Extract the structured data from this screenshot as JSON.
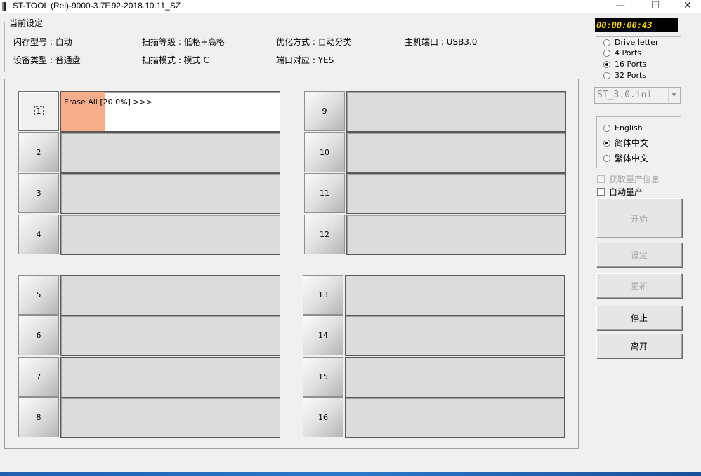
{
  "window": {
    "title": "ST-TOOL (Rel)-9000-3.7F.92-2018.10.11_SZ",
    "minimize_glyph": "—",
    "maximize_glyph": "☐",
    "close_glyph": "✕"
  },
  "settings": {
    "legend": "当前设定",
    "flash_model": "闪存型号 : 自动",
    "scan_level": "扫描等级 : 低格+高格",
    "optimize": "优化方式 : 自动分类",
    "host_port": "主机端口 : USB3.0",
    "device_type": "设备类型 : 普通盘",
    "scan_mode": "扫描模式 : 模式 C",
    "port_map": "端口对应 : YES"
  },
  "timer": "00:00:00:43",
  "port_mode": {
    "options": [
      {
        "label": "Drive letter",
        "selected": false
      },
      {
        "label": "4 Ports",
        "selected": false
      },
      {
        "label": "16 Ports",
        "selected": true
      },
      {
        "label": "32 Ports",
        "selected": false
      }
    ]
  },
  "ini_file": "ST_3.0.ini",
  "language": {
    "options": [
      {
        "label": "English",
        "selected": false
      },
      {
        "label": "简体中文",
        "selected": true
      },
      {
        "label": "繁体中文",
        "selected": false
      }
    ]
  },
  "checkboxes": {
    "get_info": {
      "label": "获取量产信息",
      "checked": false,
      "enabled": false
    },
    "auto_produce": {
      "label": "自动量产",
      "checked": false,
      "enabled": true
    }
  },
  "buttons": {
    "start": {
      "label": "开始",
      "enabled": false
    },
    "settings": {
      "label": "设定",
      "enabled": false
    },
    "update": {
      "label": "更新",
      "enabled": false
    },
    "stop": {
      "label": "停止",
      "enabled": true
    },
    "exit": {
      "label": "离开",
      "enabled": true
    }
  },
  "ports": [
    {
      "number": "1",
      "status": "Erase All [20.0%] >>>",
      "progress": 0.2,
      "active": true
    },
    {
      "number": "2",
      "status": ""
    },
    {
      "number": "3",
      "status": ""
    },
    {
      "number": "4",
      "status": ""
    },
    {
      "number": "5",
      "status": ""
    },
    {
      "number": "6",
      "status": ""
    },
    {
      "number": "7",
      "status": ""
    },
    {
      "number": "8",
      "status": ""
    },
    {
      "number": "9",
      "status": ""
    },
    {
      "number": "10",
      "status": ""
    },
    {
      "number": "11",
      "status": ""
    },
    {
      "number": "12",
      "status": ""
    },
    {
      "number": "13",
      "status": ""
    },
    {
      "number": "14",
      "status": ""
    },
    {
      "number": "15",
      "status": ""
    },
    {
      "number": "16",
      "status": ""
    }
  ],
  "colors": {
    "progress": "#f6ad8a",
    "timer_text": "#ffd800",
    "timer_bg": "#000000",
    "taskbar": "#2b78c9"
  }
}
